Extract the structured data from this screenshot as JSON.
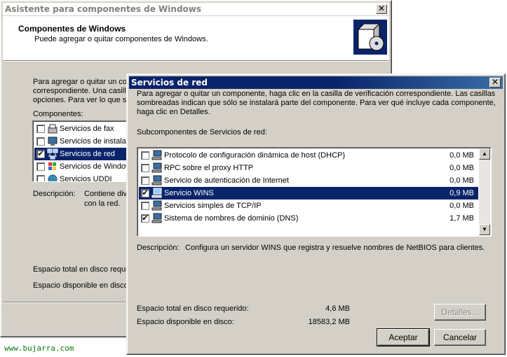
{
  "back_dialog": {
    "title": "Asistente para componentes de Windows",
    "header_title": "Componentes de Windows",
    "header_subtitle": "Puede agregar o quitar componentes de Windows.",
    "intro_line1": "Para agregar o quitar un com",
    "intro_line2": "correspondiente. Una casilla",
    "intro_line3": "opciones. Para ver lo que se",
    "components_label": "Componentes:",
    "components": [
      {
        "label": "Servicios de fax",
        "checked": false,
        "icon": "fax-icon"
      },
      {
        "label": "Servicios de instalac",
        "checked": false,
        "icon": "install-icon"
      },
      {
        "label": "Servicios de red",
        "checked": true,
        "selected": true,
        "icon": "network-icon"
      },
      {
        "label": "Servicios de Window",
        "checked": false,
        "icon": "windows-services-icon"
      },
      {
        "label": "Servicios UDDI",
        "checked": false,
        "icon": "uddi-icon"
      }
    ],
    "description_label": "Descripción:",
    "description_line1": "Contiene div",
    "description_line2": "con la red.",
    "disk_required": "Espacio total en disco requer",
    "disk_available": "Espacio disponible en disco:"
  },
  "front_dialog": {
    "title": "Servicios de red",
    "intro_line1": "Para agregar o quitar un componente, haga clic en la casilla de verificación correspondiente. Las casillas",
    "intro_line2": "sombreadas indican que sólo se instalará parte del componente. Para ver qué incluye cada componente,",
    "intro_line3": "haga clic en Detalles.",
    "subcomponents_label": "Subcomponentes de Servicios de red:",
    "subcomponents": [
      {
        "label": "Protocolo de configuración dinámica de host (DHCP)",
        "size": "0,0 MB",
        "checked": false
      },
      {
        "label": "RPC sobre el proxy HTTP",
        "size": "0,0 MB",
        "checked": false
      },
      {
        "label": "Servicio de autenticación de Internet",
        "size": "0,0 MB",
        "checked": false
      },
      {
        "label": "Servicio WINS",
        "size": "0,9 MB",
        "checked": true,
        "selected": true
      },
      {
        "label": "Servicios simples de TCP/IP",
        "size": "0,0 MB",
        "checked": false
      },
      {
        "label": "Sistema de nombres de dominio (DNS)",
        "size": "1,7 MB",
        "checked": true
      }
    ],
    "description_label": "Descripción:",
    "description_text": "Configura un servidor WINS que registra y resuelve nombres de NetBIOS para clientes.",
    "disk_required_label": "Espacio total en disco requerido:",
    "disk_required_value": "4,6 MB",
    "disk_available_label": "Espacio disponible en disco:",
    "disk_available_value": "18583,2 MB",
    "details_button": "Detalles...",
    "accept_button": "Aceptar",
    "cancel_button": "Cancelar"
  },
  "watermark": "www.bujarra.com",
  "colors": {
    "selection": "#0a246a",
    "dialog_face": "#d4d0c8",
    "watermark": "#0a7a0a"
  }
}
